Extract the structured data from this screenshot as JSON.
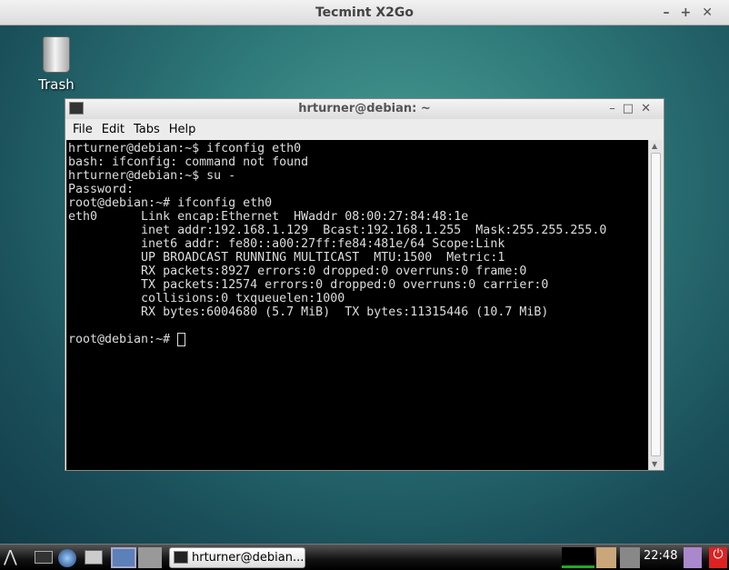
{
  "outer_window": {
    "title": "Tecmint X2Go",
    "controls": [
      "–",
      "+",
      "✕"
    ]
  },
  "desktop": {
    "icons": [
      {
        "label": "Trash"
      }
    ]
  },
  "terminal": {
    "title": "hrturner@debian: ~",
    "controls": [
      "–",
      "□",
      "✕"
    ],
    "menu": [
      "File",
      "Edit",
      "Tabs",
      "Help"
    ],
    "lines": [
      "hrturner@debian:~$ ifconfig eth0",
      "bash: ifconfig: command not found",
      "hrturner@debian:~$ su -",
      "Password:",
      "root@debian:~# ifconfig eth0",
      "eth0      Link encap:Ethernet  HWaddr 08:00:27:84:48:1e  ",
      "          inet addr:192.168.1.129  Bcast:192.168.1.255  Mask:255.255.255.0",
      "          inet6 addr: fe80::a00:27ff:fe84:481e/64 Scope:Link",
      "          UP BROADCAST RUNNING MULTICAST  MTU:1500  Metric:1",
      "          RX packets:8927 errors:0 dropped:0 overruns:0 frame:0",
      "          TX packets:12574 errors:0 dropped:0 overruns:0 carrier:0",
      "          collisions:0 txqueuelen:1000 ",
      "          RX bytes:6004680 (5.7 MiB)  TX bytes:11315446 (10.7 MiB)",
      ""
    ],
    "prompt": "root@debian:~# "
  },
  "taskbar": {
    "task_label": "hrturner@debian...",
    "clock": "22:48"
  }
}
